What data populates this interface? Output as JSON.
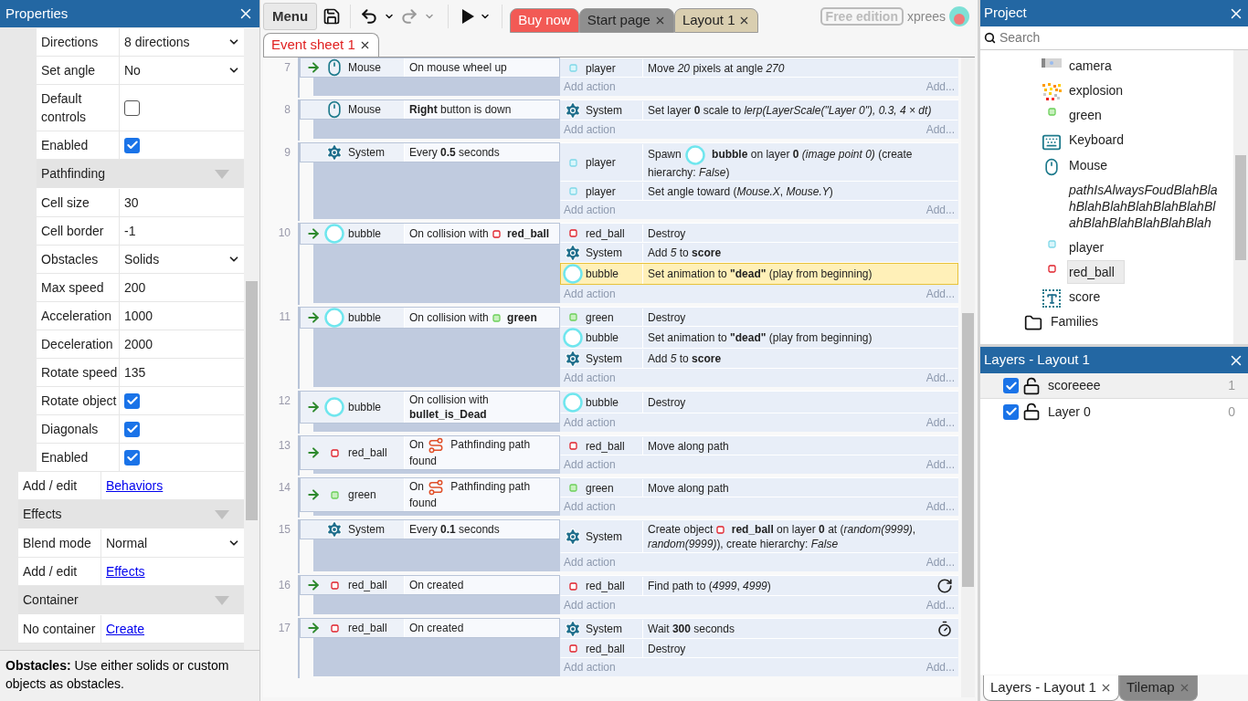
{
  "properties": {
    "title": "Properties",
    "rows": [
      {
        "kind": "group",
        "children": [
          {
            "kind": "select",
            "label": "Directions",
            "value": "8 directions"
          },
          {
            "kind": "select",
            "label": "Set angle",
            "value": "No"
          },
          {
            "kind": "checkbox",
            "label": "Default controls",
            "checked": false
          },
          {
            "kind": "checkbox",
            "label": "Enabled",
            "checked": true
          },
          {
            "kind": "section",
            "label": "Pathfinding"
          },
          {
            "kind": "text",
            "label": "Cell size",
            "value": "30"
          },
          {
            "kind": "text",
            "label": "Cell border",
            "value": "-1"
          },
          {
            "kind": "select",
            "label": "Obstacles",
            "value": "Solids"
          },
          {
            "kind": "text",
            "label": "Max speed",
            "value": "200"
          },
          {
            "kind": "text",
            "label": "Acceleration",
            "value": "1000"
          },
          {
            "kind": "text",
            "label": "Deceleration",
            "value": "2000"
          },
          {
            "kind": "text",
            "label": "Rotate speed",
            "value": "135"
          },
          {
            "kind": "checkbox",
            "label": "Rotate object",
            "checked": true
          },
          {
            "kind": "checkbox",
            "label": "Diagonals",
            "checked": true
          },
          {
            "kind": "checkbox",
            "label": "Enabled",
            "checked": true
          }
        ]
      },
      {
        "kind": "link",
        "label": "Add / edit",
        "value": "Behaviors"
      },
      {
        "kind": "section",
        "label": "Effects"
      },
      {
        "kind": "select",
        "label": "Blend mode",
        "value": "Normal"
      },
      {
        "kind": "link",
        "label": "Add / edit",
        "value": "Effects"
      },
      {
        "kind": "section",
        "label": "Container"
      },
      {
        "kind": "link",
        "label": "No container",
        "value": "Create"
      }
    ],
    "description": "**Obstacles:** Use either solids or custom objects as obstacles."
  },
  "toolbar": {
    "menu": "Menu",
    "redo_disabled": true,
    "tabs": [
      {
        "label": "Buy now",
        "kind": "buy",
        "color": "#f25a55"
      },
      {
        "label": "Start page",
        "kind": "doc",
        "color": "#8f8f8f"
      },
      {
        "label": "Layout 1",
        "kind": "doc",
        "color": "#d9ceb0"
      }
    ],
    "edition": "Free edition",
    "user": "xprees"
  },
  "sheet_tabs": [
    {
      "label": "Event sheet 1",
      "selected": true
    }
  ],
  "events": [
    {
      "number": "7",
      "trigger": true,
      "conditions": [
        {
          "kind": "mouse",
          "object": "Mouse",
          "segments": [
            {
              "kind": "text",
              "text": "On mouse wheel up"
            }
          ]
        }
      ],
      "actions": [
        {
          "kind": "player",
          "object": "player",
          "segments": [
            {
              "kind": "text",
              "text": "Move *20* pixels at angle *270*"
            }
          ],
          "selected": false
        }
      ],
      "add_action": "Add action",
      "add_more": "Add..."
    },
    {
      "number": "8",
      "trigger": false,
      "conditions": [
        {
          "kind": "mouse",
          "object": "Mouse",
          "segments": [
            {
              "kind": "text",
              "text": "**Right** button is down"
            }
          ]
        }
      ],
      "actions": [
        {
          "kind": "system",
          "object": "System",
          "segments": [
            {
              "kind": "text",
              "text": "Set layer **0** scale to *lerp(LayerScale(\"Layer 0\"), 0.3, 4 × dt)*"
            }
          ],
          "selected": false
        }
      ],
      "add_action": "Add action",
      "add_more": "Add..."
    },
    {
      "number": "9",
      "trigger": false,
      "conditions": [
        {
          "kind": "system",
          "object": "System",
          "segments": [
            {
              "kind": "text",
              "text": "Every **0.5** seconds"
            }
          ]
        }
      ],
      "actions": [
        {
          "kind": "player",
          "object": "player",
          "segments": [
            {
              "kind": "text",
              "text": "Spawn"
            },
            {
              "kind": "bubble"
            },
            {
              "kind": "text",
              "text": "**bubble** on layer **0** *(image point 0)* (create hierarchy: *False*)"
            }
          ],
          "selected": false
        },
        {
          "kind": "player",
          "object": "player",
          "segments": [
            {
              "kind": "text",
              "text": "Set angle toward (*Mouse.X*, *Mouse.Y*)"
            }
          ],
          "selected": false
        }
      ],
      "add_action": "Add action",
      "add_more": "Add..."
    },
    {
      "number": "10",
      "trigger": true,
      "conditions": [
        {
          "kind": "bubble",
          "object": "bubble",
          "segments": [
            {
              "kind": "text",
              "text": "On collision with"
            },
            {
              "kind": "red"
            },
            {
              "kind": "text",
              "text": "**red_ball**"
            }
          ]
        }
      ],
      "actions": [
        {
          "kind": "red",
          "object": "red_ball",
          "segments": [
            {
              "kind": "text",
              "text": "Destroy"
            }
          ],
          "selected": false
        },
        {
          "kind": "system",
          "object": "System",
          "segments": [
            {
              "kind": "text",
              "text": "Add *5* to **score**"
            }
          ],
          "selected": false
        },
        {
          "kind": "bubble",
          "object": "bubble",
          "segments": [
            {
              "kind": "text",
              "text": "Set animation to **\"dead\"** (play from beginning)"
            }
          ],
          "selected": true
        }
      ],
      "add_action": "Add action",
      "add_more": "Add..."
    },
    {
      "number": "11",
      "trigger": true,
      "conditions": [
        {
          "kind": "bubble",
          "object": "bubble",
          "segments": [
            {
              "kind": "text",
              "text": "On collision with"
            },
            {
              "kind": "green"
            },
            {
              "kind": "text",
              "text": "**green**"
            }
          ]
        }
      ],
      "actions": [
        {
          "kind": "green",
          "object": "green",
          "segments": [
            {
              "kind": "text",
              "text": "Destroy"
            }
          ],
          "selected": false
        },
        {
          "kind": "bubble",
          "object": "bubble",
          "segments": [
            {
              "kind": "text",
              "text": "Set animation to **\"dead\"** (play from beginning)"
            }
          ],
          "selected": false
        },
        {
          "kind": "system",
          "object": "System",
          "segments": [
            {
              "kind": "text",
              "text": "Add *5* to **score**"
            }
          ],
          "selected": false
        }
      ],
      "add_action": "Add action",
      "add_more": "Add..."
    },
    {
      "number": "12",
      "trigger": true,
      "conditions": [
        {
          "kind": "bubble",
          "object": "bubble",
          "segments": [
            {
              "kind": "text",
              "text": "On collision with **bullet_is_Dead**"
            }
          ]
        }
      ],
      "actions": [
        {
          "kind": "bubble",
          "object": "bubble",
          "segments": [
            {
              "kind": "text",
              "text": "Destroy"
            }
          ],
          "selected": false
        }
      ],
      "add_action": "Add action",
      "add_more": "Add..."
    },
    {
      "number": "13",
      "trigger": true,
      "conditions": [
        {
          "kind": "red",
          "object": "red_ball",
          "segments": [
            {
              "kind": "text",
              "text": "On"
            },
            {
              "kind": "path"
            },
            {
              "kind": "text",
              "text": "Pathfinding path found"
            }
          ]
        }
      ],
      "actions": [
        {
          "kind": "red",
          "object": "red_ball",
          "segments": [
            {
              "kind": "text",
              "text": "Move along path"
            }
          ],
          "selected": false
        }
      ],
      "add_action": "Add action",
      "add_more": "Add..."
    },
    {
      "number": "14",
      "trigger": true,
      "conditions": [
        {
          "kind": "green",
          "object": "green",
          "segments": [
            {
              "kind": "text",
              "text": "On"
            },
            {
              "kind": "path"
            },
            {
              "kind": "text",
              "text": "Pathfinding path found"
            }
          ]
        }
      ],
      "actions": [
        {
          "kind": "green",
          "object": "green",
          "segments": [
            {
              "kind": "text",
              "text": "Move along path"
            }
          ],
          "selected": false
        }
      ],
      "add_action": "Add action",
      "add_more": "Add..."
    },
    {
      "number": "15",
      "trigger": false,
      "conditions": [
        {
          "kind": "system",
          "object": "System",
          "segments": [
            {
              "kind": "text",
              "text": "Every **0.1** seconds"
            }
          ]
        }
      ],
      "actions": [
        {
          "kind": "system",
          "object": "System",
          "segments": [
            {
              "kind": "text",
              "text": "Create object"
            },
            {
              "kind": "red"
            },
            {
              "kind": "text",
              "text": "**red_ball** on layer **0** at (*random(9999)*, *random(9999)*), create hierarchy: *False*"
            }
          ],
          "selected": false
        }
      ],
      "add_action": "Add action",
      "add_more": "Add..."
    },
    {
      "number": "16",
      "trigger": true,
      "conditions": [
        {
          "kind": "red",
          "object": "red_ball",
          "segments": [
            {
              "kind": "text",
              "text": "On created"
            }
          ]
        }
      ],
      "actions": [
        {
          "kind": "red",
          "object": "red_ball",
          "segments": [
            {
              "kind": "text",
              "text": "Find path to (*4999*, *4999*)"
            },
            {
              "kind": "async"
            }
          ],
          "selected": false
        }
      ],
      "add_action": "Add action",
      "add_more": "Add..."
    },
    {
      "number": "17",
      "trigger": true,
      "conditions": [
        {
          "kind": "red",
          "object": "red_ball",
          "segments": [
            {
              "kind": "text",
              "text": "On created"
            }
          ]
        }
      ],
      "actions": [
        {
          "kind": "system",
          "object": "System",
          "segments": [
            {
              "kind": "text",
              "text": "Wait **300** seconds"
            },
            {
              "kind": "wait"
            }
          ],
          "selected": false
        },
        {
          "kind": "red",
          "object": "red_ball",
          "segments": [
            {
              "kind": "text",
              "text": "Destroy"
            }
          ],
          "selected": false
        }
      ],
      "add_action": "Add action",
      "add_more": "Add..."
    }
  ],
  "project": {
    "title": "Project",
    "search_placeholder": "Search",
    "tree": [
      {
        "kind": "group",
        "children": [
          {
            "kind": "sprite",
            "label": "camera",
            "selected": false
          },
          {
            "kind": "particles",
            "label": "explosion",
            "selected": false
          },
          {
            "kind": "green",
            "label": "green",
            "selected": false
          },
          {
            "kind": "keyboard",
            "label": "Keyboard",
            "selected": false
          },
          {
            "kind": "mouse",
            "label": "Mouse",
            "selected": false
          },
          {
            "kind": "variable",
            "label": "pathIsAlwaysFoudBlahBlahBlahBlahBlahBlahBlahBlahBlahBlahBlahBlahBlah",
            "selected": false
          },
          {
            "kind": "player",
            "label": "player",
            "selected": false
          },
          {
            "kind": "red",
            "label": "red_ball",
            "selected": true
          },
          {
            "kind": "text",
            "label": "score",
            "selected": false
          }
        ]
      },
      {
        "kind": "folder",
        "label": "Families",
        "selected": false
      }
    ]
  },
  "layers": {
    "title": "Layers - Layout 1",
    "items": [
      {
        "name": "scoreeee",
        "index": "1",
        "visible": true,
        "locked": false,
        "selected": true
      },
      {
        "name": "Layer 0",
        "index": "0",
        "visible": true,
        "locked": false,
        "selected": false
      }
    ]
  },
  "bottom_tabs": [
    {
      "label": "Layers - Layout 1",
      "selected": true
    },
    {
      "label": "Tilemap",
      "selected": false
    }
  ]
}
